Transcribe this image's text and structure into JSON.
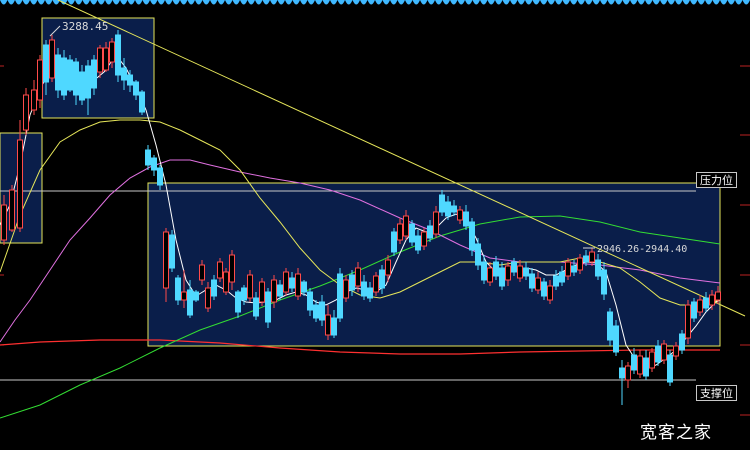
{
  "chart_data": {
    "type": "candlestick",
    "annotations": {
      "peak_label": "3288.45",
      "range_label": "2946.26-2944.40",
      "resistance_label": "压力位",
      "support_label": "支撑位"
    },
    "watermark": "宽客之家",
    "colors": {
      "up": "#ff4b4b",
      "down": "#4fd8ff",
      "box_fill": "#0a1e4a",
      "box_stroke": "#e6e65a",
      "trendline": "#e6e65a",
      "hline": "#c8c8c8",
      "ma5": "#ffffff",
      "ma20": "#e6e65a",
      "ma60": "#e070e0",
      "ma120": "#33dd33",
      "ma250": "#ff3030"
    }
  }
}
